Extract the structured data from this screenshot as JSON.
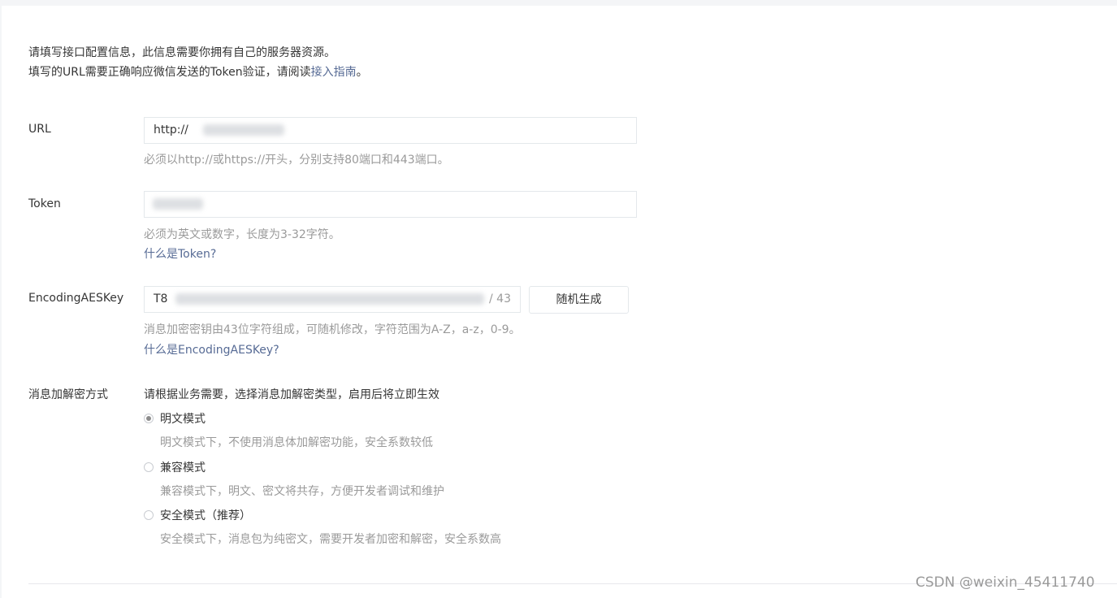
{
  "intro": {
    "line1": "请填写接口配置信息，此信息需要你拥有自己的服务器资源。",
    "line2_prefix": "填写的URL需要正确响应微信发送的Token验证，请阅读",
    "line2_link": "接入指南",
    "line2_suffix": "。"
  },
  "url": {
    "label": "URL",
    "value": "http://",
    "help": "必须以http://或https://开头，分别支持80端口和443端口。"
  },
  "token": {
    "label": "Token",
    "value": "",
    "help": "必须为英文或数字，长度为3-32字符。",
    "link": "什么是Token?"
  },
  "aes": {
    "label": "EncodingAESKey",
    "value": "T8",
    "counter": "/ 43",
    "button": "随机生成",
    "help": "消息加密密钥由43位字符组成，可随机修改，字符范围为A-Z，a-z，0-9。",
    "link": "什么是EncodingAESKey?"
  },
  "encryption": {
    "label": "消息加解密方式",
    "description": "请根据业务需要，选择消息加解密类型，启用后将立即生效",
    "modes": [
      {
        "label": "明文模式",
        "desc": "明文模式下，不使用消息体加解密功能，安全系数较低",
        "checked": true
      },
      {
        "label": "兼容模式",
        "desc": "兼容模式下，明文、密文将共存，方便开发者调试和维护",
        "checked": false
      },
      {
        "label": "安全模式（推荐）",
        "desc": "安全模式下，消息包为纯密文，需要开发者加密和解密，安全系数高",
        "checked": false
      }
    ]
  },
  "watermark": "CSDN @weixin_45411740"
}
